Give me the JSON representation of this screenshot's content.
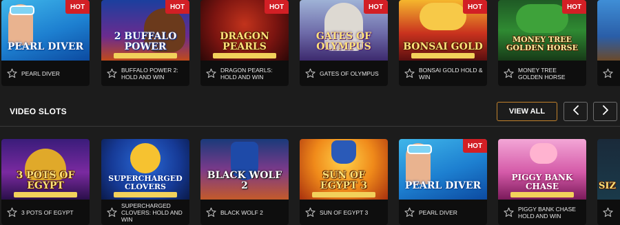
{
  "top_row": [
    {
      "title": "PEARL DIVER",
      "logo": "Pearl Diver",
      "hot": "HOT"
    },
    {
      "title": "BUFFALO POWER 2: HOLD AND WIN",
      "logo": "2 Buffalo Power",
      "hot": "HOT"
    },
    {
      "title": "DRAGON PEARLS: HOLD AND WIN",
      "logo": "Dragon Pearls",
      "hot": "HOT"
    },
    {
      "title": "GATES OF OLYMPUS",
      "logo": "Gates of Olympus",
      "hot": "HOT"
    },
    {
      "title": "BONSAI GOLD HOLD & WIN",
      "logo": "Bonsai Gold",
      "hot": "HOT"
    },
    {
      "title": "MONEY TREE GOLDEN HORSE",
      "logo": "Money Tree Golden Horse",
      "hot": "HOT"
    },
    {
      "title": "",
      "logo": "",
      "hot": ""
    }
  ],
  "section": {
    "title": "VIDEO SLOTS",
    "view_all": "VIEW ALL",
    "prev_icon": "chevron-left-icon",
    "next_icon": "chevron-right-icon"
  },
  "bottom_row": [
    {
      "title": "3 POTS OF EGYPT",
      "logo": "3 Pots of Egypt",
      "hot": ""
    },
    {
      "title": "SUPERCHARGED CLOVERS: HOLD AND WIN",
      "logo": "Supercharged Clovers",
      "hot": ""
    },
    {
      "title": "BLACK WOLF 2",
      "logo": "Black Wolf 2",
      "hot": ""
    },
    {
      "title": "SUN OF EGYPT 3",
      "logo": "Sun of Egypt 3",
      "hot": ""
    },
    {
      "title": "PEARL DIVER",
      "logo": "Pearl Diver",
      "hot": "HOT"
    },
    {
      "title": "PIGGY BANK CHASE HOLD AND WIN",
      "logo": "Piggy Bank Chase",
      "hot": ""
    },
    {
      "title": "",
      "logo": "Siz",
      "hot": ""
    }
  ],
  "colors": {
    "hot_badge": "#d21f25",
    "view_all_border": "#c3832c",
    "background": "#1c1c1c",
    "card_footer": "#0e0e0e"
  },
  "icons": {
    "favorite": "star-outline-icon"
  }
}
